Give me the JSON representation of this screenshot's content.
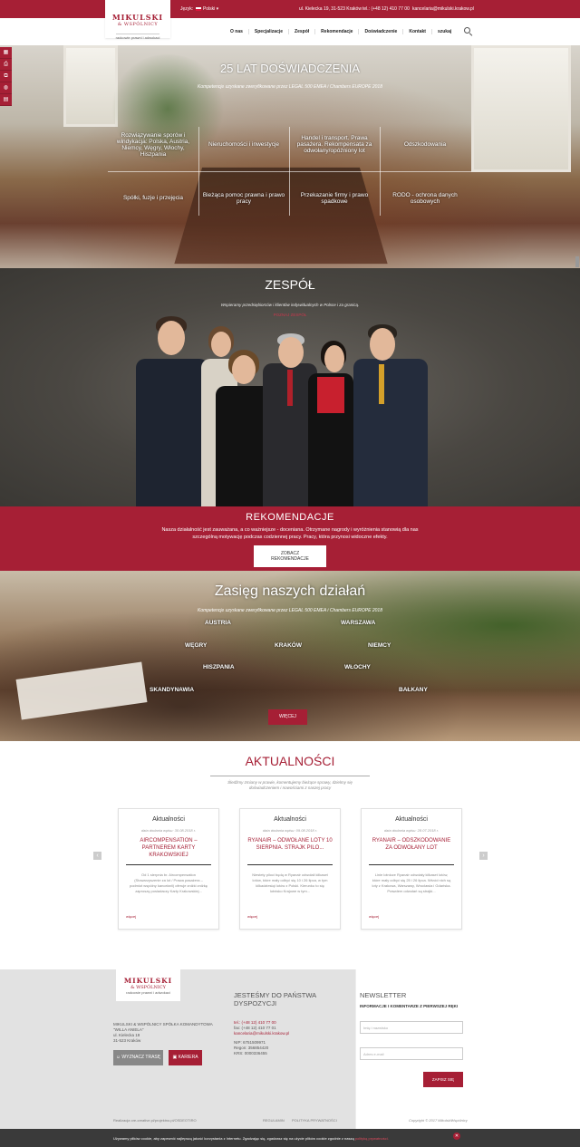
{
  "topbar": {
    "language_label": "Język:",
    "language_value": "Polski",
    "address": "ul. Kielecka 19, 31-523 Kraków",
    "phone": "tel.: (+48 12) 410 77 00",
    "email": "kancelaria@mikulski.krakow.pl"
  },
  "logo": {
    "line1": "MIKULSKI",
    "line2": "& WSPÓLNICY",
    "line3": "radcowie prawni i adwokaci"
  },
  "nav": {
    "items": [
      "O nas",
      "Specjalizacje",
      "Zespół",
      "Rekomendacje",
      "Doświadczenie",
      "Kontakt",
      "szukaj"
    ]
  },
  "side_icons": [
    "calendar-icon",
    "print-icon",
    "share-icon",
    "globe-icon",
    "language-icon"
  ],
  "hero": {
    "title": "25 LAT DOŚWIADCZENIA",
    "subtitle": "Kompetencje uzyskane zweryfikowane przez LEGAL 500 EMEA i Chambers EUROPE 2018",
    "cells": [
      "Rozwiązywanie sporów i windykacja: Polska, Austria, Niemcy, Węgry, Włochy, Hiszpania",
      "Nieruchomości i inwestycje",
      "Handel i transport. Prawa pasażera. Rekompensata za odwołany/opóźniony lot",
      "Odszkodowania",
      "Spółki, fuzje i przejęcia",
      "Bieżąca pomoc prawna i prawo pracy",
      "Przekazanie firmy i prawo spadkowe",
      "RODO - ochrona danych osobowych"
    ]
  },
  "team": {
    "title": "ZESPÓŁ",
    "subtitle": "Wspieramy przedsiębiorców i klientów indywidualnych w Polsce i za granicą.",
    "link": "POZNAJ ZESPÓŁ"
  },
  "reco": {
    "title": "REKOMENDACJE",
    "text": "Nasza działalność jest zauważana, a co ważniejsze - doceniana. Otrzymane nagrody i wyróżnienia stanowią dla nas szczególną motywację podczas codziennej pracy. Pracy, która przynosi widoczne efekty.",
    "button": "ZOBACZ REKOMENDACJE"
  },
  "zasieg": {
    "title": "Zasięg naszych działań",
    "subtitle": "Kompetencje uzyskane zweryfikowane przez LEGAL 500 EMEA i Chambers EUROPE 2018",
    "places": [
      "AUSTRIA",
      "WARSZAWA",
      "WĘGRY",
      "KRAKÓW",
      "NIEMCY",
      "HISZPANIA",
      "WŁOCHY",
      "SKANDYNAWIA",
      "BAŁKANY"
    ],
    "button": "WIĘCEJ"
  },
  "news": {
    "title": "AKTUALNOŚCI",
    "subtitle": "Śledźmy zmiany w prawie, komentujemy bieżące sprawy, dzielmy się doświadczeniem i nowościami z naszej pracy",
    "cards": [
      {
        "category": "Aktualności",
        "date": "data dodania wpisu: 30.08.2018 r.",
        "headline": "AIRCOMPENSATION – PARTNEREM KARTY KRAKOWSKIEJ",
        "excerpt": "Od 1 sierpnia br. Aircompensation (Stowarzyszenie za lot / Prawa pasażera – podmiot wspólny kancelarii) oferuje zniżki zniżkę zaproszę posiadaczy Karty Krakowskiej...",
        "more": "więcej"
      },
      {
        "category": "Aktualności",
        "date": "data dodania wpisu: 09.08.2018 r.",
        "headline": "RYANAIR – ODWOŁANE LOTY 10 SIERPNIA. STRAJK PILO...",
        "excerpt": "Niestety piloci będą w Ryanair odwołali kilkaset lotów, które mały odbyć się 10 i 26 lipca, w tym kilkadziesiąt lotów z Polski. Kierunku to się lotnisko Krajowe w tym...",
        "more": "więcej"
      },
      {
        "category": "Aktualności",
        "date": "data dodania wpisu: 28.07.2018 r.",
        "headline": "RYANAIR – ODSZKODOWANIE ZA ODWOŁANY LOT",
        "excerpt": "Linie lotnicze Ryanair odwołały kilkaset lotów, które mały odbyć się 25 i 26 lipca. Wśród nich są loty z Krakowa, Warszawy, Wrocławia i Gdańska. Prawdem odwołań są strajki...",
        "more": "więcej"
      }
    ]
  },
  "footer": {
    "company": "MIKULSKI & WSPÓLNICY SPÓŁKA KOMANDYTOWA",
    "villa": "\"WILLA ANIELA\"",
    "street": "ul. Kielecka 19",
    "city": "31-523 Kraków",
    "btn_route": "WYZNACZ TRASĘ",
    "btn_career": "KARIERA",
    "heading": "JESTEŚMY DO PAŃSTWA DYSPOZYCJI",
    "tel": "tel.: (+48 12) 410 77 00",
    "fax": "fax: (+48 12) 410 77 01",
    "email": "kancelaria@mikulski.krakow.pl",
    "nip": "NIP: 6751509971",
    "regon": "Regon: 356854420",
    "krs": "KRS: 0000336455",
    "credits": "Realizacja cre-creative.pl/projektno.pl/OSDEOTIRO",
    "regulamin": "REGULAMIN",
    "privacy": "POLITYKA PRYWATNOŚCI"
  },
  "newsletter": {
    "title": "NEWSLETTER",
    "subtitle": "INFORMACJE I KOMENTARZE Z PIERWSZEJ RĘKI",
    "name_placeholder": "Imię i nazwisko",
    "email_placeholder": "Adres e-mail",
    "button": "ZAPISZ SIĘ",
    "copyright": "Copyright © 2017 MikulskiWspólnicy"
  },
  "cookie": {
    "text": "Używamy plików cookie, aby zapewnić najlepszą jakość korzystania z Internetu. Zgadzając się, zgadzasz się na użycie plików cookie zgodnie z naszą",
    "link": "polityką prywatności.",
    "close": "✕"
  }
}
